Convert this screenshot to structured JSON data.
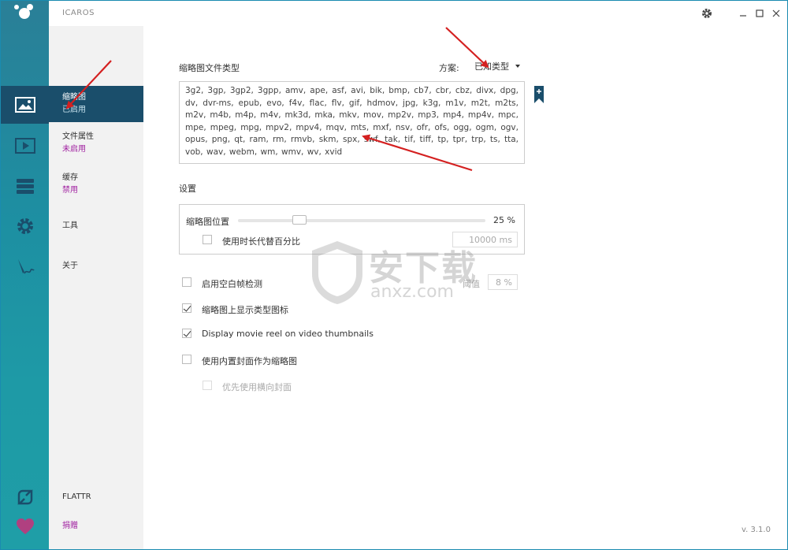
{
  "app": {
    "title": "ICAROS",
    "version": "v. 3.1.0"
  },
  "nav": {
    "items": [
      {
        "label": "缩略图",
        "status": "已启用"
      },
      {
        "label": "文件属性",
        "status": "未启用"
      },
      {
        "label": "缓存",
        "status": "禁用"
      },
      {
        "label": "工具",
        "status": ""
      },
      {
        "label": "关于",
        "status": ""
      }
    ],
    "flattr": "FLATTR",
    "donate": "捐赠"
  },
  "thumbnails": {
    "section_title": "缩略图文件类型",
    "scheme_label": "方案:",
    "scheme_value": "已知类型",
    "extensions": "3g2, 3gp, 3gp2, 3gpp, amv, ape, asf, avi, bik, bmp, cb7, cbr, cbz, divx, dpg, dv, dvr-ms, epub, evo, f4v, flac, flv, gif, hdmov, jpg, k3g, m1v, m2t, m2ts, m2v, m4b, m4p, m4v, mk3d, mka, mkv, mov, mp2v, mp3, mp4, mp4v, mpc, mpe, mpeg, mpg, mpv2, mpv4, mqv, mts, mxf, nsv, ofr, ofs, ogg, ogm, ogv, opus, png, qt, ram, rm, rmvb, skm, spx, swf, tak, tif, tiff, tp, tpr, trp, ts, tta, vob, wav, webm, wm, wmv, wv, xvid"
  },
  "settings": {
    "title": "设置",
    "thumb_position_label": "缩略图位置",
    "thumb_position_value": "25 %",
    "thumb_position_fraction": 0.25,
    "use_duration_label": "使用时长代替百分比",
    "use_duration_checked": false,
    "duration_value": "10000 ms",
    "blank_frame_label": "启用空白帧检测",
    "blank_frame_checked": false,
    "threshold_label": "阈值",
    "threshold_value": "8 %",
    "show_type_icon_label": "缩略图上显示类型图标",
    "show_type_icon_checked": true,
    "movie_reel_label": "Display movie reel on video thumbnails",
    "movie_reel_checked": true,
    "embedded_cover_label": "使用内置封面作为缩略图",
    "embedded_cover_checked": false,
    "landscape_cover_label": "优先使用横向封面",
    "landscape_cover_checked": false
  },
  "watermark": {
    "main": "安下载",
    "sub": "anxz.com"
  },
  "colors": {
    "accent": "#1a4e6b",
    "status_purple": "#a020a0",
    "arrow": "#d42020"
  }
}
